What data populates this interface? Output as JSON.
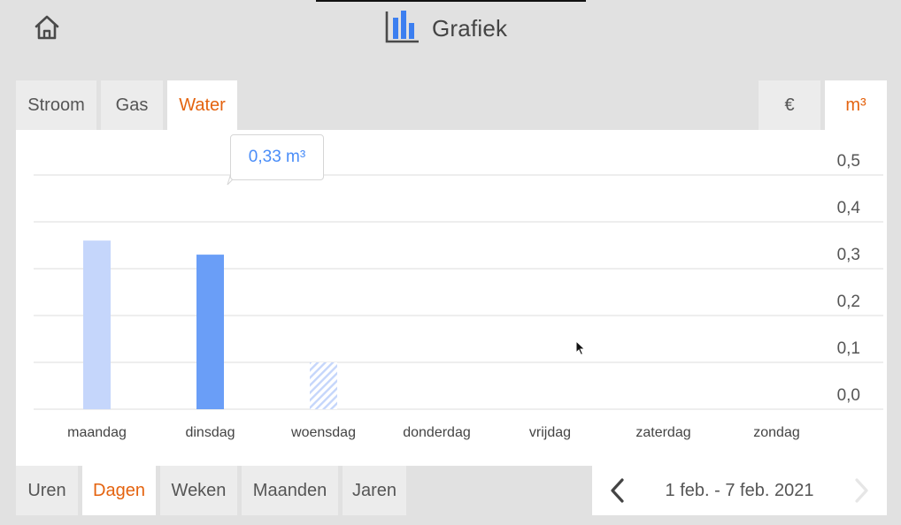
{
  "header": {
    "title": "Grafiek",
    "home_icon": "home-icon",
    "chart_icon": "bar-chart-icon"
  },
  "energy_tabs": [
    {
      "label": "Stroom",
      "active": false
    },
    {
      "label": "Gas",
      "active": false
    },
    {
      "label": "Water",
      "active": true
    }
  ],
  "unit_tabs": [
    {
      "label": "€",
      "active": false
    },
    {
      "label": "m³",
      "active": true
    }
  ],
  "tooltip": {
    "text": "0,33 m³"
  },
  "period_tabs": [
    {
      "label": "Uren",
      "active": false
    },
    {
      "label": "Dagen",
      "active": true
    },
    {
      "label": "Weken",
      "active": false
    },
    {
      "label": "Maanden",
      "active": false
    },
    {
      "label": "Jaren",
      "active": false
    }
  ],
  "date_range": {
    "label": "1 feb. - 7 feb. 2021",
    "prev_icon": "chevron-left-icon",
    "next_icon": "chevron-right-icon"
  },
  "colors": {
    "accent": "#e4630f",
    "bar_selected": "#6a9ef7",
    "bar_default": "#c5d6fb",
    "bar_forecast_stripe": "#c5d6fb",
    "tooltip_text": "#4a8df8"
  },
  "chart_data": {
    "type": "bar",
    "categories": [
      "maandag",
      "dinsdag",
      "woensdag",
      "donderdag",
      "vrijdag",
      "zaterdag",
      "zondag"
    ],
    "values": [
      0.36,
      0.33,
      0.1,
      0,
      0,
      0,
      0
    ],
    "selected_index": 1,
    "forecast_index": 2,
    "ylim": [
      0,
      0.5
    ],
    "yticks": [
      "0,5",
      "0,4",
      "0,3",
      "0,2",
      "0,1",
      "0,0"
    ],
    "ytick_values": [
      0.5,
      0.4,
      0.3,
      0.2,
      0.1,
      0.0
    ],
    "y_axis_position": "right",
    "grid": true
  }
}
